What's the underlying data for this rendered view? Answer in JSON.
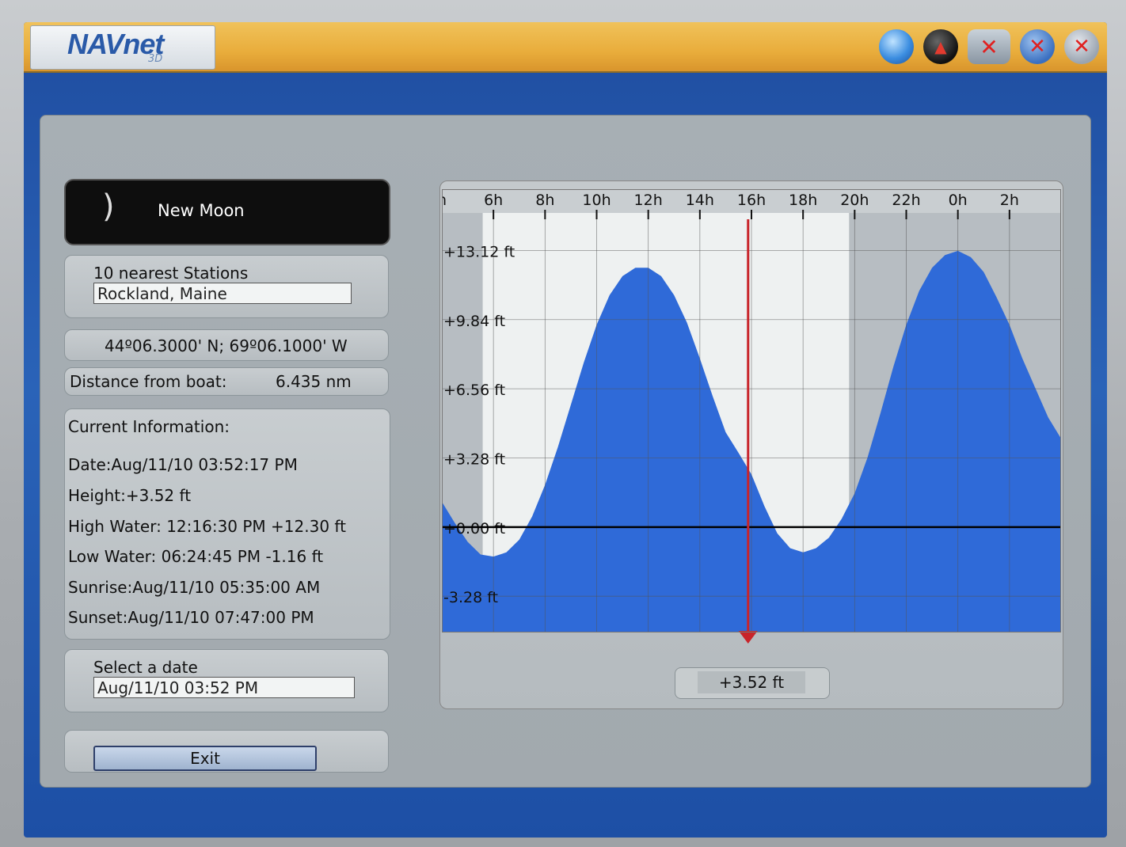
{
  "app": {
    "logo_text": "NAVnet",
    "logo_sub": "3D"
  },
  "toolbar": {
    "icons": [
      "globe-icon",
      "compass-icon",
      "network-disconnect-icon",
      "close-circle-icon",
      "exit-icon"
    ]
  },
  "moon": {
    "phase": "New Moon",
    "glyph": ")"
  },
  "stations": {
    "label": "10 nearest Stations",
    "value": "Rockland, Maine"
  },
  "position": {
    "coordinates": "44º06.3000' N; 69º06.1000' W"
  },
  "distance": {
    "label": "Distance from boat:",
    "value": "6.435 nm"
  },
  "current": {
    "title": "Current Information:",
    "date": "Date:Aug/11/10 03:52:17 PM",
    "height": "Height:+3.52 ft",
    "high_water": "High Water: 12:16:30 PM +12.30 ft",
    "low_water": "Low Water: 06:24:45 PM -1.16 ft",
    "sunrise": "Sunrise:Aug/11/10 05:35:00 AM",
    "sunset": "Sunset:Aug/11/10 07:47:00 PM"
  },
  "date_select": {
    "label": "Select a date",
    "value": "Aug/11/10 03:52 PM"
  },
  "exit": {
    "label": "Exit"
  },
  "readout": {
    "value": "+3.52 ft"
  },
  "colors": {
    "tide_fill": "#2f6ad8",
    "cursor": "#c8242a",
    "day": "#eef1f1",
    "night": "#b7bdc2"
  },
  "chart_data": {
    "type": "area",
    "x_tick_labels": [
      "h",
      "6h",
      "8h",
      "10h",
      "12h",
      "14h",
      "16h",
      "18h",
      "20h",
      "22h",
      "0h",
      "2h"
    ],
    "x_ticks_hours": [
      4,
      6,
      8,
      10,
      12,
      14,
      16,
      18,
      20,
      22,
      24,
      26
    ],
    "xlim": [
      4,
      28
    ],
    "y_tick_labels": [
      "+13.12 ft",
      "+9.84 ft",
      "+6.56 ft",
      "+3.28 ft",
      "+0.00 ft",
      "-3.28 ft"
    ],
    "y_ticks": [
      13.12,
      9.84,
      6.56,
      3.28,
      0,
      -3.28
    ],
    "ylim": [
      -5.0,
      14.9
    ],
    "series": [
      {
        "x": [
          4.0,
          4.5,
          5.0,
          5.5,
          6.0,
          6.5,
          7.0,
          7.5,
          8.0,
          8.5,
          9.0,
          9.5,
          10.0,
          10.5,
          11.0,
          11.5,
          12.0,
          12.5,
          13.0,
          13.5,
          14.0,
          14.5,
          15.0,
          15.5,
          16.0,
          16.5,
          17.0,
          17.5,
          18.0,
          18.5,
          19.0,
          19.5,
          20.0,
          20.5,
          21.0,
          21.5,
          22.0,
          22.5,
          23.0,
          23.5,
          24.0,
          24.5,
          25.0,
          25.5,
          26.0,
          26.5,
          27.0,
          27.5,
          28.0
        ],
        "y": [
          1.2,
          0.2,
          -0.7,
          -1.3,
          -1.4,
          -1.2,
          -0.6,
          0.5,
          2.0,
          3.8,
          5.8,
          7.8,
          9.6,
          11.0,
          11.9,
          12.3,
          12.3,
          11.9,
          11.0,
          9.7,
          8.0,
          6.2,
          4.5,
          3.52,
          2.5,
          1.0,
          -0.3,
          -1.0,
          -1.2,
          -1.0,
          -0.5,
          0.4,
          1.6,
          3.3,
          5.4,
          7.6,
          9.6,
          11.2,
          12.3,
          12.9,
          13.1,
          12.8,
          12.1,
          10.9,
          9.6,
          8.0,
          6.6,
          5.2,
          4.2
        ]
      }
    ],
    "day_shading": {
      "sunrise_hour": 5.583,
      "sunset_hour": 19.783
    },
    "cursor_hour": 15.87,
    "grid": true
  }
}
